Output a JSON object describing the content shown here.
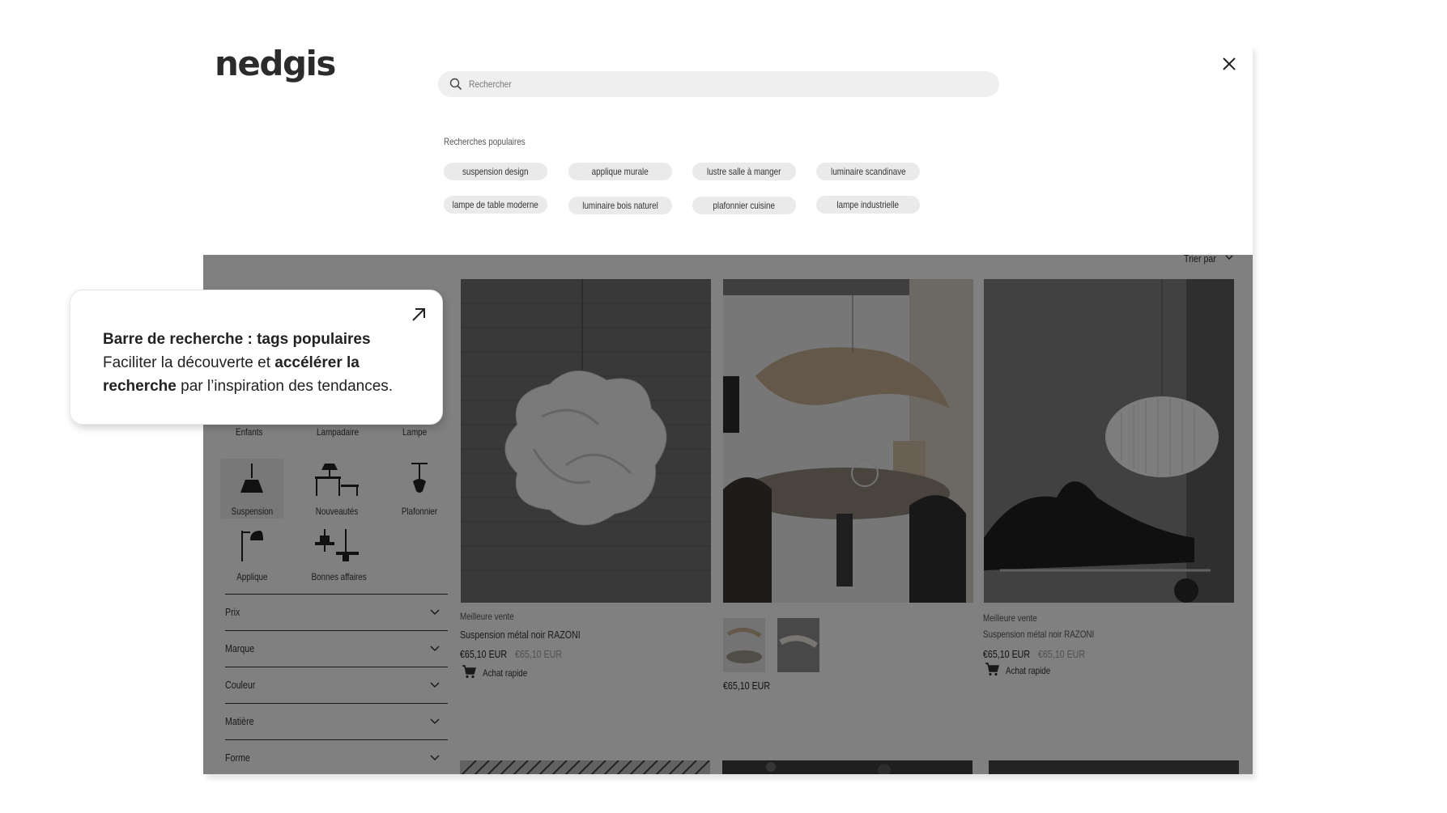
{
  "logo": "nedgis",
  "search": {
    "placeholder": "Rechercher"
  },
  "popular": {
    "title": "Recherches populaires",
    "tags": [
      "suspension design",
      "applique murale",
      "lustre salle à manger",
      "luminaire scandinave",
      "lampe de table moderne",
      "luminaire bois naturel",
      "plafonnier cuisine",
      "lampe industrielle"
    ]
  },
  "sort": {
    "label": "Trier par"
  },
  "categories": {
    "top_labels": [
      "Enfants",
      "Lampadaire",
      "Lampe"
    ],
    "items": [
      "Suspension",
      "Nouveautés",
      "Plafonnier",
      "Applique",
      "Bonnes affaires"
    ]
  },
  "filters": [
    "Prix",
    "Marque",
    "Couleur",
    "Matière",
    "Forme"
  ],
  "products": [
    {
      "badge": "Meilleure vente",
      "name": "Suspension métal noir RAZONI",
      "price": "€65,10 EUR",
      "old_price": "€65,10 EUR",
      "quick": "Achat rapide"
    },
    {
      "price": "€65,10 EUR"
    },
    {
      "badge": "Meilleure vente",
      "name": "Suspension métal noir RAZONI",
      "price": "€65,10 EUR",
      "old_price": "€65,10 EUR",
      "quick": "Achat rapide"
    }
  ],
  "callout": {
    "title": "Barre de recherche : tags populaires",
    "line_a": "Faciliter la découverte et ",
    "strong_a": "accélérer la recherche",
    "line_b": " par l’inspiration des tendances."
  },
  "colors": {
    "overlay": "#00000080",
    "tag_bg": "#eaeaea",
    "search_bg": "#efefef"
  }
}
